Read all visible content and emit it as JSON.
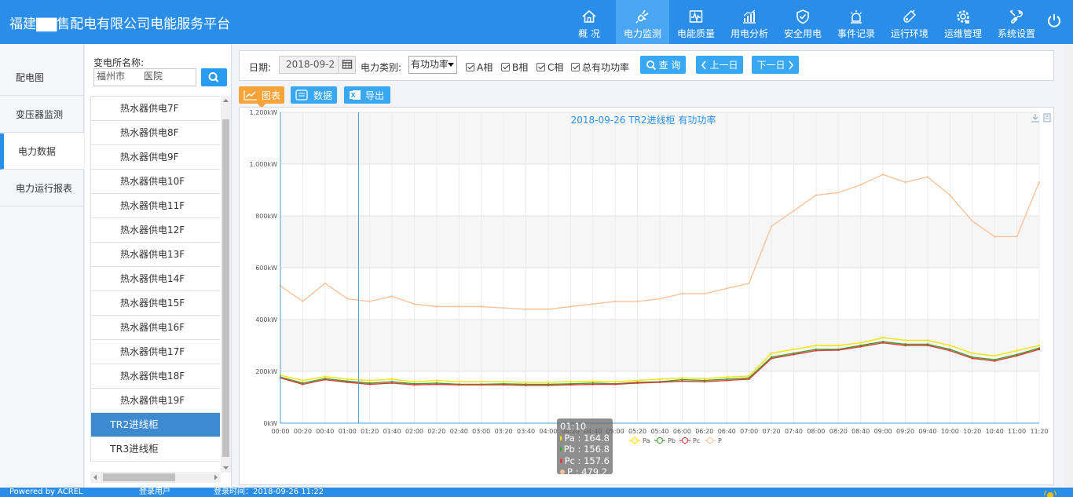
{
  "app": {
    "title": "福建▇▇售配电有限公司电能服务平台"
  },
  "nav": [
    {
      "label": "概 况",
      "icon": "home-icon"
    },
    {
      "label": "电力监测",
      "icon": "plug-icon",
      "active": true
    },
    {
      "label": "电能质量",
      "icon": "waveform-icon"
    },
    {
      "label": "用电分析",
      "icon": "bar-chart-icon"
    },
    {
      "label": "安全用电",
      "icon": "shield-check-icon"
    },
    {
      "label": "事件记录",
      "icon": "alarm-light-icon"
    },
    {
      "label": "运行环境",
      "icon": "thermometer-icon"
    },
    {
      "label": "运维管理",
      "icon": "gear-badge-icon"
    },
    {
      "label": "系统设置",
      "icon": "tools-icon"
    }
  ],
  "leftmenu": [
    {
      "label": "配电图"
    },
    {
      "label": "变压器监测"
    },
    {
      "label": "电力数据",
      "active": true
    },
    {
      "label": "电力运行报表"
    }
  ],
  "tree": {
    "station_label": "变电所名称:",
    "station_value": "福州市　　医院",
    "rows": [
      {
        "label": "热水器供电7F",
        "level": 2
      },
      {
        "label": "热水器供电8F",
        "level": 2
      },
      {
        "label": "热水器供电9F",
        "level": 2
      },
      {
        "label": "热水器供电10F",
        "level": 2
      },
      {
        "label": "热水器供电11F",
        "level": 2
      },
      {
        "label": "热水器供电12F",
        "level": 2
      },
      {
        "label": "热水器供电13F",
        "level": 2
      },
      {
        "label": "热水器供电14F",
        "level": 2
      },
      {
        "label": "热水器供电15F",
        "level": 2
      },
      {
        "label": "热水器供电16F",
        "level": 2
      },
      {
        "label": "热水器供电17F",
        "level": 2
      },
      {
        "label": "热水器供电18F",
        "level": 2
      },
      {
        "label": "热水器供电19F",
        "level": 2
      },
      {
        "label": "TR2进线柜",
        "level": 1,
        "selected": true
      },
      {
        "label": "TR3进线柜",
        "level": 1
      }
    ]
  },
  "filter": {
    "date_label": "日期:",
    "date_value": "2018-09-2",
    "type_label": "电力类别:",
    "type_value": "有功功率",
    "checks": [
      "A相",
      "B相",
      "C相",
      "总有功功率"
    ],
    "query": "查 询",
    "prev": "上一日",
    "next": "下一日"
  },
  "tabs": {
    "chart": "图表",
    "data": "数据",
    "export": "导出"
  },
  "chart_data": {
    "type": "line",
    "title": "2018-09-26 TR2进线柜 有功功率",
    "ylim": [
      0,
      1200
    ],
    "yticks": [
      "0kW",
      "200kW",
      "400kW",
      "600kW",
      "800kW",
      "1,000kW",
      "1,200kW"
    ],
    "xticks": [
      "00:00",
      "00:20",
      "00:40",
      "01:00",
      "01:20",
      "01:40",
      "02:00",
      "02:20",
      "02:40",
      "03:00",
      "03:20",
      "03:40",
      "04:00",
      "04:20",
      "04:40",
      "05:00",
      "05:20",
      "05:40",
      "06:00",
      "06:20",
      "06:40",
      "07:00",
      "07:20",
      "07:40",
      "08:00",
      "08:20",
      "08:40",
      "09:00",
      "09:20",
      "09:40",
      "10:00",
      "10:20",
      "10:40",
      "11:00",
      "11:20"
    ],
    "x": [
      "00:00",
      "00:20",
      "00:40",
      "01:00",
      "01:20",
      "01:40",
      "02:00",
      "02:20",
      "02:40",
      "03:00",
      "03:20",
      "03:40",
      "04:00",
      "04:20",
      "04:40",
      "05:00",
      "05:20",
      "05:40",
      "06:00",
      "06:20",
      "06:40",
      "07:00",
      "07:20",
      "07:40",
      "08:00",
      "08:20",
      "08:40",
      "09:00",
      "09:20",
      "09:40",
      "10:00",
      "10:20",
      "10:40",
      "11:00",
      "11:20"
    ],
    "series": [
      {
        "name": "Pa",
        "color": "#f5e400",
        "values": [
          185,
          165,
          180,
          170,
          165,
          170,
          160,
          165,
          160,
          160,
          160,
          158,
          158,
          160,
          162,
          160,
          165,
          170,
          175,
          172,
          178,
          182,
          270,
          285,
          300,
          300,
          310,
          330,
          320,
          320,
          300,
          270,
          260,
          280,
          300
        ]
      },
      {
        "name": "Pb",
        "color": "#3aa12d",
        "values": [
          178,
          155,
          172,
          162,
          155,
          160,
          152,
          155,
          150,
          150,
          152,
          150,
          150,
          152,
          155,
          152,
          158,
          160,
          168,
          165,
          170,
          175,
          255,
          270,
          285,
          285,
          300,
          315,
          305,
          305,
          285,
          255,
          245,
          265,
          290
        ]
      },
      {
        "name": "Pc",
        "color": "#e53a3a",
        "values": [
          175,
          150,
          168,
          158,
          150,
          155,
          148,
          150,
          148,
          148,
          148,
          146,
          146,
          148,
          150,
          150,
          155,
          158,
          162,
          160,
          165,
          170,
          250,
          265,
          280,
          282,
          295,
          310,
          300,
          300,
          280,
          250,
          240,
          260,
          285
        ]
      },
      {
        "name": "P",
        "color": "#f8c39a",
        "values": [
          530,
          470,
          540,
          480,
          470,
          490,
          460,
          450,
          450,
          450,
          445,
          440,
          440,
          450,
          460,
          470,
          470,
          480,
          500,
          500,
          520,
          540,
          760,
          820,
          880,
          890,
          920,
          960,
          930,
          950,
          880,
          780,
          720,
          720,
          930
        ]
      }
    ],
    "grid": true,
    "legend_position": "bottom-center"
  },
  "tooltip": {
    "time": "01:10",
    "rows": [
      {
        "name": "Pa",
        "value": "164.8",
        "color": "#f5e400"
      },
      {
        "name": "Pb",
        "value": "156.8",
        "color": "#3aa12d"
      },
      {
        "name": "Pc",
        "value": "157.6",
        "color": "#e53a3a"
      },
      {
        "name": "P",
        "value": "479.2",
        "color": "#f8c39a"
      }
    ]
  },
  "status": {
    "left": "Powered by ACREL",
    "user": "登录用户",
    "login_time": "登录时间：2018-09-26 11:22"
  }
}
